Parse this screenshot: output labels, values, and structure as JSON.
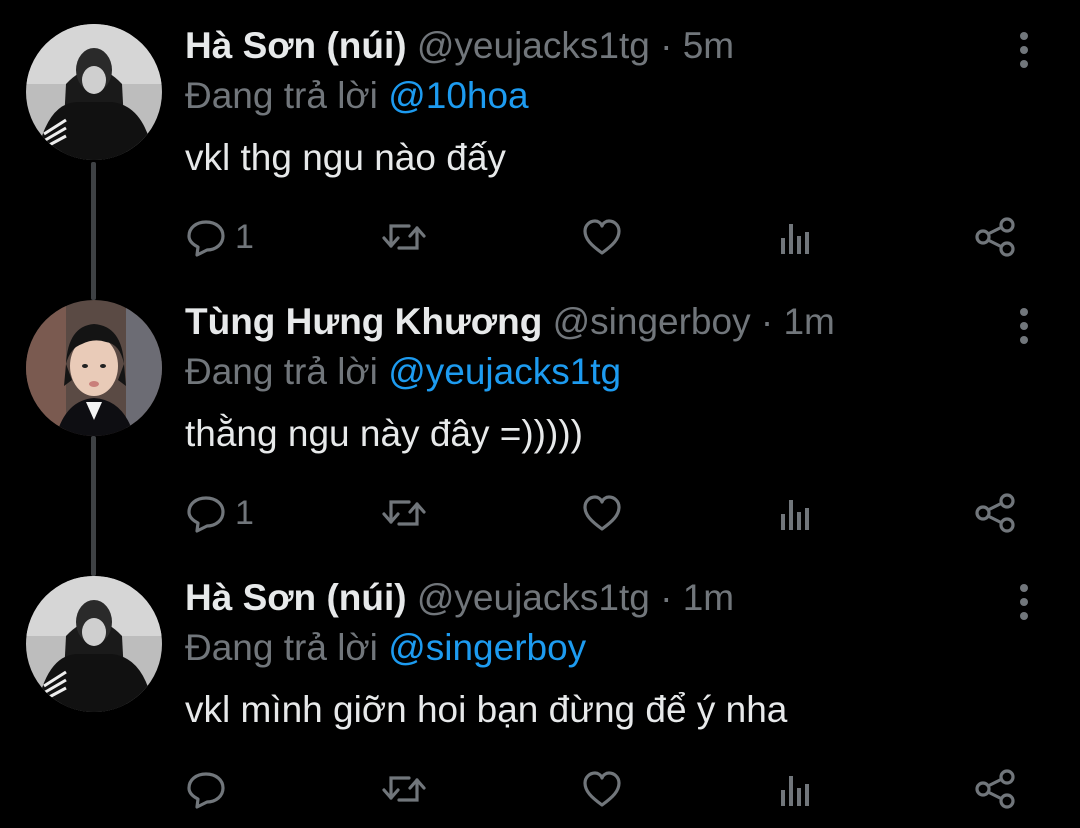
{
  "accent_color": "#1d9bf0",
  "secondary_text_color": "#71767b",
  "tweets": [
    {
      "display_name": "Hà Sơn (núi)",
      "handle": "@yeujacks1tg",
      "separator": "·",
      "time": "5m",
      "reply_prefix": "Đang trả lời",
      "reply_mention": "@10hoa",
      "text": "vkl thg ngu nào đấy",
      "reply_count": "1",
      "avatar_icon": "user-photo-dark-jacket"
    },
    {
      "display_name": "Tùng Hưng Khương",
      "handle": "@singerboy",
      "separator": "·",
      "time": "1m",
      "reply_prefix": "Đang trả lời",
      "reply_mention": "@yeujacks1tg",
      "text": "thằng ngu này đây =)))))",
      "reply_count": "1",
      "avatar_icon": "user-photo-black-hair"
    },
    {
      "display_name": "Hà Sơn (núi)",
      "handle": "@yeujacks1tg",
      "separator": "·",
      "time": "1m",
      "reply_prefix": "Đang trả lời",
      "reply_mention": "@singerboy",
      "text": "vkl mình giỡn hoi bạn đừng để ý nha",
      "reply_count": "",
      "avatar_icon": "user-photo-dark-jacket"
    }
  ],
  "action_icons": [
    "reply-icon",
    "retweet-icon",
    "like-icon",
    "analytics-icon",
    "share-icon"
  ],
  "more_icon": "more-vertical-icon"
}
